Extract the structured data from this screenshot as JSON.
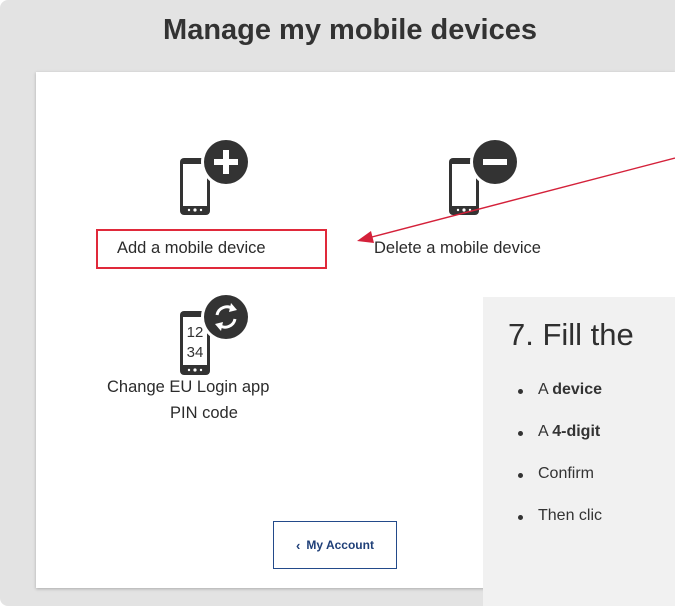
{
  "title": "Manage my mobile devices",
  "tiles": {
    "add": {
      "label": "Add a mobile device"
    },
    "delete": {
      "label": "Delete a mobile device"
    },
    "change_pin": {
      "line1": "Change EU Login app",
      "line2": "PIN code",
      "icon_digits": [
        "12",
        "34"
      ]
    }
  },
  "my_account_button": {
    "label": "My Account"
  },
  "instruction_overlay": {
    "heading": "7. Fill the",
    "bullets": [
      {
        "prefix": "A ",
        "bold": "device"
      },
      {
        "prefix": "A ",
        "bold": "4-digit"
      },
      {
        "prefix": "Confirm",
        "bold": ""
      },
      {
        "prefix": "Then clic",
        "bold": ""
      }
    ]
  },
  "colors": {
    "highlight_border": "#e0293a",
    "annotation_arrow": "#d4213a",
    "button_border": "#234a8a",
    "icon_dark": "#333333"
  },
  "icons": [
    "phone-add-icon",
    "phone-remove-icon",
    "phone-pin-icon",
    "chevron-left-icon"
  ]
}
